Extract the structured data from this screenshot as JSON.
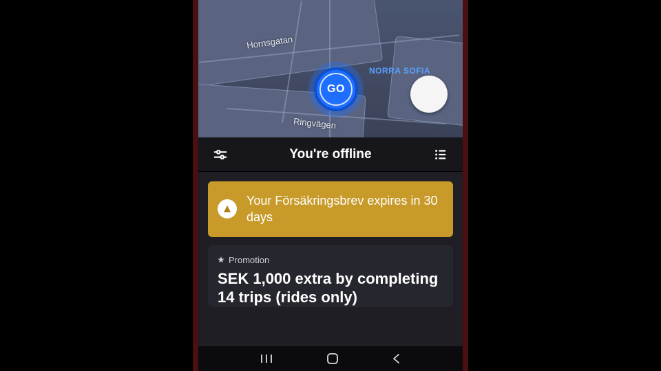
{
  "map": {
    "go_label": "GO",
    "district": "NORRA SOFIA",
    "roads": {
      "top": "Hornsgatan",
      "bottom": "Ringvägen"
    }
  },
  "status": {
    "title": "You're offline"
  },
  "alert": {
    "icon_glyph": "▲",
    "text": "Your Försäkringsbrev expires in 30 days"
  },
  "promotion": {
    "tag": "Promotion",
    "title": "SEK 1,000 extra by completing 14 trips (rides only)"
  },
  "colors": {
    "go_blue": "#1f6fff",
    "alert_gold": "#c79a2a",
    "panel_dark": "#1e1e24"
  }
}
